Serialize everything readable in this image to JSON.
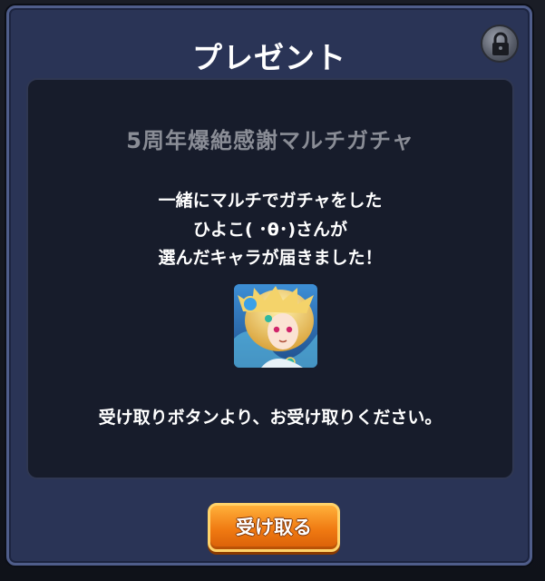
{
  "dialog": {
    "title": "プレゼント",
    "lock_icon": "lock-icon"
  },
  "gacha": {
    "name": "5周年爆絶感謝マルチガチャ"
  },
  "message": {
    "line1": "一緒にマルチでガチャをした",
    "line2": "ひよこ( ･θ･)さんが",
    "line3": "選んだキャラが届きました！"
  },
  "character": {
    "icon": "character-portrait-icon"
  },
  "instruction": "受け取りボタンより、お受け取りください。",
  "button": {
    "receive_label": "受け取る"
  },
  "colors": {
    "dialog_bg": "#2a3456",
    "inner_bg": "#171c2b",
    "button_orange": "#f07a12",
    "gacha_title_gray": "#8a8d96"
  }
}
